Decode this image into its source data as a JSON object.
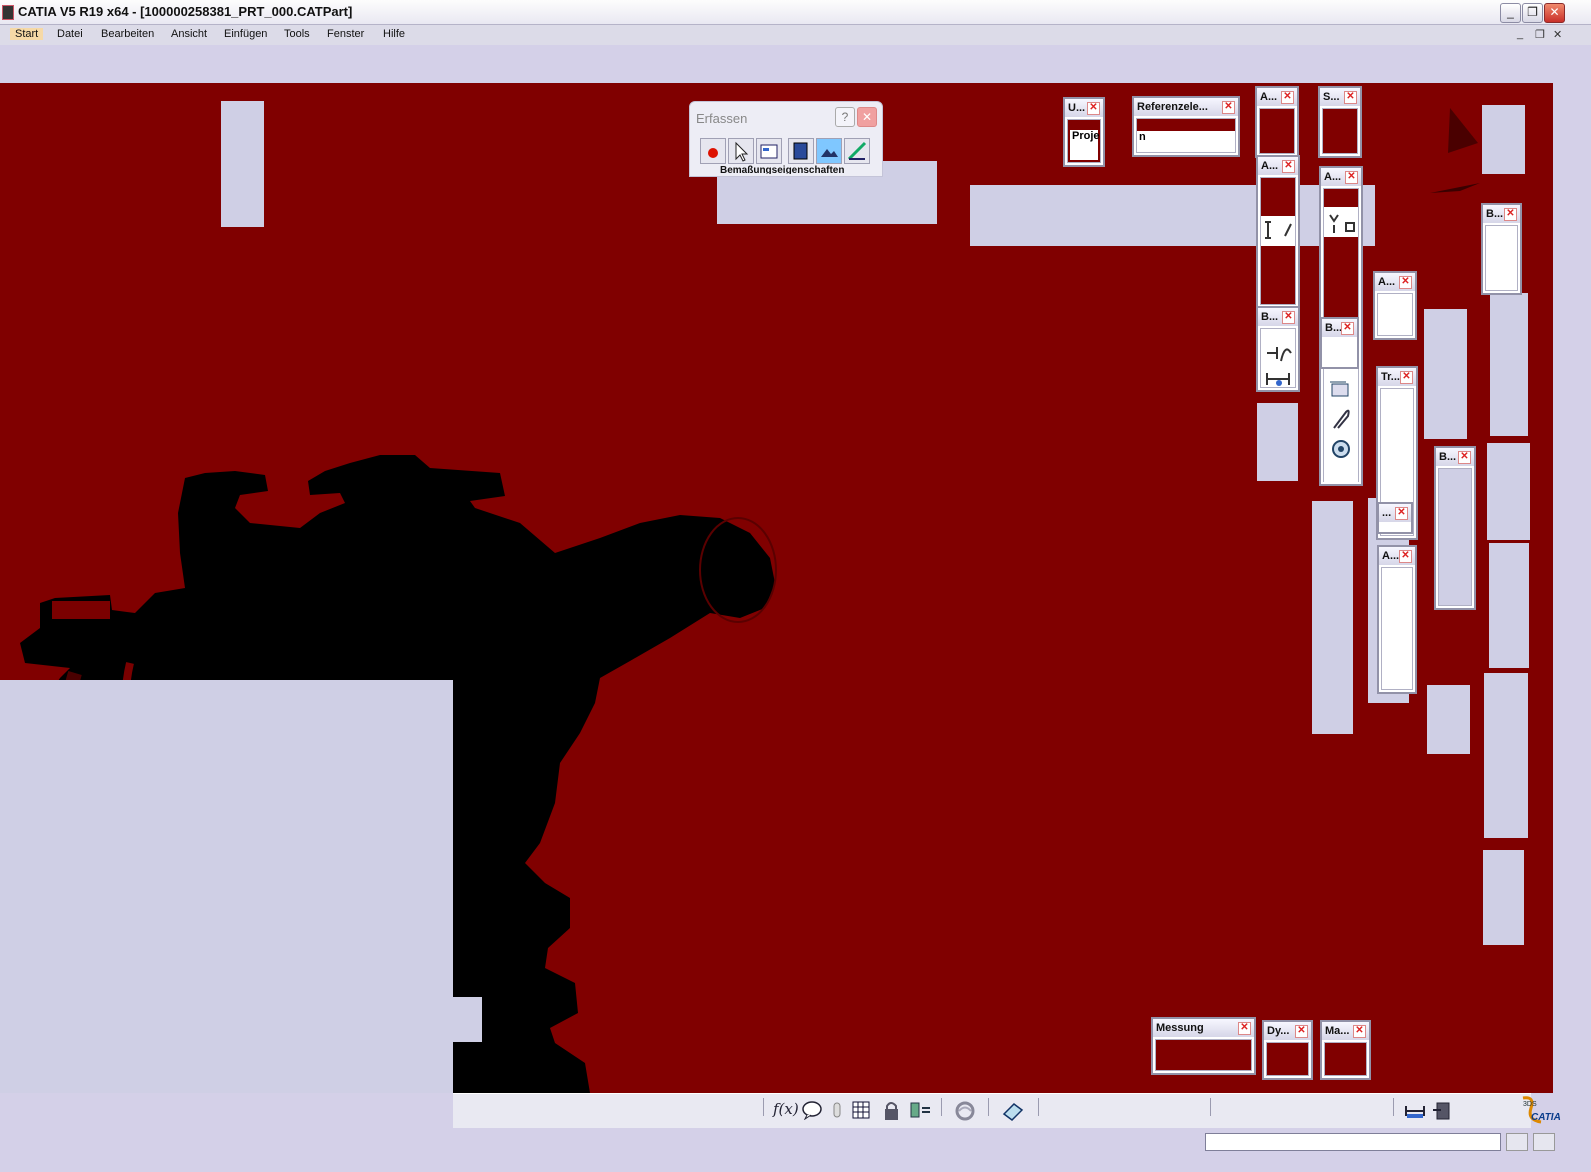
{
  "window": {
    "title": "CATIA V5 R19 x64 - [100000258381_PRT_000.CATPart]",
    "min": "_",
    "max": "❐",
    "close": "✕"
  },
  "menu": {
    "items": [
      "Start",
      "Datei",
      "Bearbeiten",
      "Ansicht",
      "Einfügen",
      "Tools",
      "Fenster",
      "Hilfe"
    ],
    "mdi_min": "_",
    "mdi_restore": "❐",
    "mdi_close": "✕"
  },
  "dialog": {
    "title": "Erfassen",
    "help": "?",
    "close": "✕",
    "tooltip": "Bemaßungseigenschaften"
  },
  "toolbars": {
    "u": "U...",
    "u_body": "Proje",
    "referenz": "Referenzele...",
    "referenz_body": "n",
    "a1": "A...",
    "s1": "S...",
    "a2": "A...",
    "a3": "A...",
    "b1": "B...",
    "b2": "B...",
    "b3": "B...",
    "a4": "A...",
    "tr": "Tr...",
    "dots": "...",
    "a5": "A...",
    "messung": "Messung",
    "dy": "Dy...",
    "ma": "Ma...",
    "close_glyph": "✕"
  },
  "bottom_toolbar": {
    "icons": [
      "formula-icon",
      "comment-icon",
      "hand-icon",
      "table-icon",
      "lock-icon",
      "knowledge-icon",
      "refresh-icon",
      "catalog-icon",
      "measure-icon",
      "export-icon"
    ],
    "formula_label": "f(x)"
  },
  "brand": {
    "logo_text": "CATIA",
    "logo_mark": "3DS"
  },
  "colors": {
    "viewport_bg": "#800000",
    "part_silhouette": "#000000",
    "panel_bg": "#cfcfe5"
  }
}
